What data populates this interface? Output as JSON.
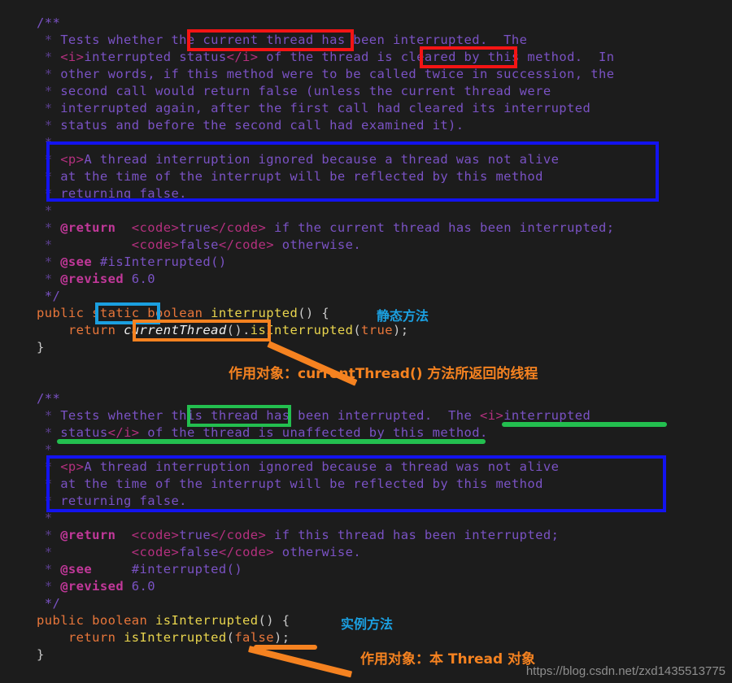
{
  "theme": {
    "background": "#1c1c1c",
    "comment_color": "#7a52c4",
    "tag_color": "#c2389a",
    "keyword_color": "#e8763a",
    "method_color": "#e8d44d",
    "red_box": "#f41414",
    "blue_box": "#1313f0",
    "cyan_box": "#1b9fe0",
    "orange_box": "#f58220",
    "green_box": "#23bf4f"
  },
  "code": {
    "block_one": {
      "javadoc_open": "/**",
      "lines": [
        " * Tests whether the current thread has been interrupted.  The",
        " * <i>interrupted status</i> of the thread is cleared by this method.  In",
        " * other words, if this method were to be called twice in succession, the",
        " * second call would return false (unless the current thread were",
        " * interrupted again, after the first call had cleared its interrupted",
        " * status and before the second call had examined it).",
        " *",
        " * <p>A thread interruption ignored because a thread was not alive",
        " * at the time of the interrupt will be reflected by this method",
        " * returning false.",
        " *",
        " * @return  <code>true</code> if the current thread has been interrupted;",
        " *          <code>false</code> otherwise.",
        " * @see #isInterrupted()",
        " * @revised 6.0",
        " */"
      ],
      "signature": "public static boolean interrupted() {",
      "body": "    return currentThread().isInterrupted(true);",
      "close": "}"
    },
    "block_two": {
      "javadoc_open": "/**",
      "lines": [
        " * Tests whether this thread has been interrupted.  The <i>interrupted",
        " * status</i> of the thread is unaffected by this method.",
        " *",
        " * <p>A thread interruption ignored because a thread was not alive",
        " * at the time of the interrupt will be reflected by this method",
        " * returning false.",
        " *",
        " * @return  <code>true</code> if this thread has been interrupted;",
        " *          <code>false</code> otherwise.",
        " * @see     #interrupted()",
        " * @revised 6.0",
        " */"
      ],
      "signature": "public boolean isInterrupted() {",
      "body": "    return isInterrupted(false);",
      "close": "}"
    }
  },
  "annotations": {
    "highlight_current_thread": "the current thread",
    "highlight_is_cleared": "is cleared",
    "highlight_this_thread": "this thread",
    "highlight_static": "static",
    "highlight_current_thread_call": "currentThread()",
    "note_static_method": "静态方法",
    "note_instance_method": "实例方法",
    "note_target_current_thread": "作用对象：currentThread() 方法所返回的线程",
    "note_target_this_thread": "作用对象：本 Thread 对象"
  },
  "watermark": {
    "url": "https://blog.csdn.net/zxd1435513775"
  }
}
